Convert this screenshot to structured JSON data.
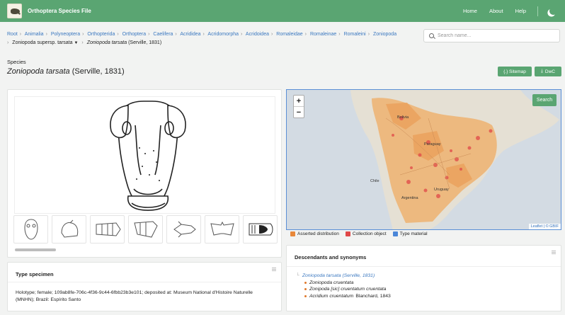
{
  "header": {
    "brand": "Orthoptera Species File",
    "links": [
      "Home",
      "About",
      "Help"
    ]
  },
  "breadcrumb": {
    "items": [
      "Root",
      "Animalia",
      "Polyneoptera",
      "Orthopterida",
      "Orthoptera",
      "Caelifera",
      "Acrididea",
      "Acridomorpha",
      "Acridoidea",
      "Romaleidae",
      "Romaleinae",
      "Romaleini",
      "Zoniopoda"
    ],
    "supersp": "Zoniopoda supersp. tarsata",
    "current_name": "Zoniopoda tarsata",
    "current_author": "(Serville, 1831)"
  },
  "search": {
    "placeholder": "Search name..."
  },
  "taxon": {
    "rank": "Species",
    "name": "Zoniopoda tarsata",
    "author": "(Serville, 1831)"
  },
  "actions": {
    "sitemap": "{.} Sitemap",
    "dwc": "DwC"
  },
  "map": {
    "search": "Search",
    "zoom_in": "+",
    "zoom_out": "−",
    "attribution": "Leaflet | © GBIF",
    "labels": [
      "Bolivia",
      "Paraguay",
      "Chile",
      "Uruguay",
      "Argentina"
    ],
    "legend": [
      {
        "label": "Asserted distribution",
        "color": "#e8883a"
      },
      {
        "label": "Collection object",
        "color": "#e04848"
      },
      {
        "label": "Type material",
        "color": "#4a86d8"
      }
    ]
  },
  "type_specimen": {
    "title": "Type specimen",
    "text": "Holotype; female; 109ab8fe-706c-4f36-9c44-6fbb23b3e101; deposited at: Museum National d'Histoire Naturelle (MNHN); Brazil: Espírito Santo"
  },
  "descendants": {
    "title": "Descendants and synonyms",
    "main": "Zoniopoda tarsata (Serville, 1831)",
    "synonyms": [
      {
        "name": "Zoniopoda cruentata",
        "extra": ""
      },
      {
        "name": "Zonipoda [sic] cruentatum cruentata",
        "extra": ""
      },
      {
        "name": "Acridium cruentatum",
        "extra": "Blanchard, 1843"
      }
    ]
  }
}
